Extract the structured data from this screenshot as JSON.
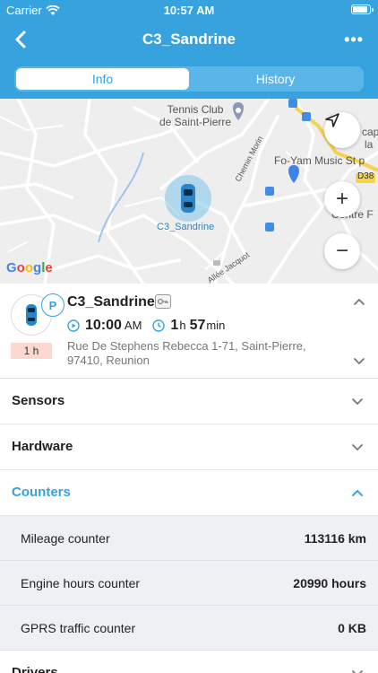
{
  "status": {
    "carrier": "Carrier",
    "time": "10:57 AM"
  },
  "nav": {
    "title": "C3_Sandrine",
    "more": "•••"
  },
  "tabs": [
    {
      "label": "Info",
      "active": true
    },
    {
      "label": "History",
      "active": false
    }
  ],
  "map": {
    "labels": {
      "tennis": "Tennis Club\nde Saint-Pierre",
      "foyam": "Fo-Yam Music St p",
      "cap": "cap",
      "lab": "la",
      "d38": "D38",
      "centre": "Centre F",
      "chemin": "Chemin Morin",
      "allee": "Allée Jacquot",
      "car_label": "C3_Sandrine"
    },
    "google": "Google",
    "zoom_in": "+",
    "zoom_out": "−"
  },
  "vehicle": {
    "name": "C3_Sandrine",
    "parking_badge": "P",
    "duration_badge": "1 h",
    "start_time": "10:00",
    "start_ampm": "AM",
    "elapsed_h": "1",
    "elapsed_h_unit": "h",
    "elapsed_m": "57",
    "elapsed_m_unit": "min",
    "address": "Rue De Stephens Rebecca 1-71, Saint-Pierre, 97410, Reunion"
  },
  "sections": {
    "sensors": "Sensors",
    "hardware": "Hardware",
    "counters": "Counters",
    "drivers": "Drivers"
  },
  "counters": [
    {
      "label": "Mileage counter",
      "value": "113116 km"
    },
    {
      "label": "Engine hours counter",
      "value": "20990 hours"
    },
    {
      "label": "GPRS traffic counter",
      "value": "0 KB"
    }
  ],
  "colors": {
    "accent": "#36a3df",
    "badge_bg": "#fbd8d2",
    "row_bg": "#eef0f4"
  }
}
